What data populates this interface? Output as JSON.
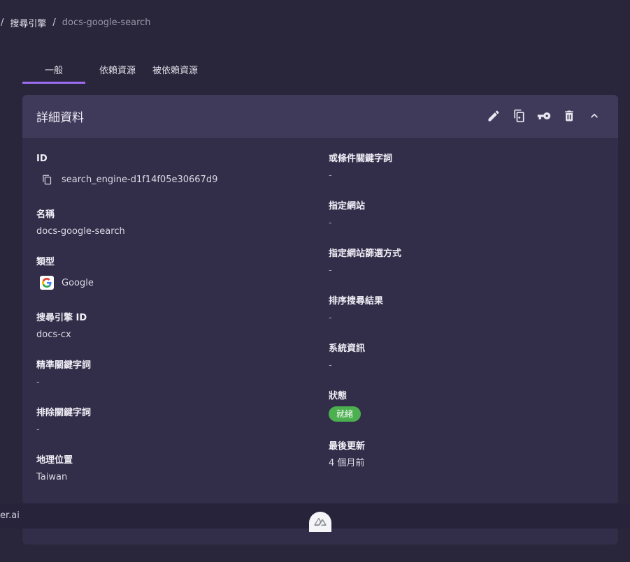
{
  "breadcrumb": {
    "separator": "/",
    "items": [
      "搜尋引擎"
    ],
    "current": "docs-google-search"
  },
  "tabs": [
    {
      "label": "一般",
      "active": true
    },
    {
      "label": "依賴資源",
      "active": false
    },
    {
      "label": "被依賴資源",
      "active": false
    }
  ],
  "card": {
    "title": "詳細資料",
    "actions": [
      "edit-icon",
      "duplicate-icon",
      "key-icon",
      "delete-icon",
      "collapse-icon"
    ]
  },
  "left_fields": {
    "id": {
      "label": "ID",
      "value": "search_engine-d1f14f05e30667d9"
    },
    "name": {
      "label": "名稱",
      "value": "docs-google-search"
    },
    "type": {
      "label": "類型",
      "value": "Google"
    },
    "engine_id": {
      "label": "搜尋引擎 ID",
      "value": "docs-cx"
    },
    "exact_keywords": {
      "label": "精準關鍵字詞",
      "value": "-"
    },
    "exclude_keywords": {
      "label": "排除關鍵字詞",
      "value": "-"
    },
    "location": {
      "label": "地理位置",
      "value": "Taiwan"
    }
  },
  "right_fields": {
    "or_keywords": {
      "label": "或條件關鍵字詞",
      "value": "-"
    },
    "site": {
      "label": "指定網站",
      "value": "-"
    },
    "site_filter": {
      "label": "指定網站篩選方式",
      "value": "-"
    },
    "sort": {
      "label": "排序搜尋結果",
      "value": "-"
    },
    "system_info": {
      "label": "系統資訊",
      "value": "-"
    },
    "status": {
      "label": "狀態",
      "value": "就緒",
      "color": "#4caf50"
    },
    "updated": {
      "label": "最後更新",
      "value": "4 個月前"
    }
  },
  "footer": {
    "text": "er.ai"
  },
  "colors": {
    "accent": "#9b6cf0",
    "background": "#29253a",
    "card": "#322d48",
    "card_header": "#3f3a5a"
  }
}
